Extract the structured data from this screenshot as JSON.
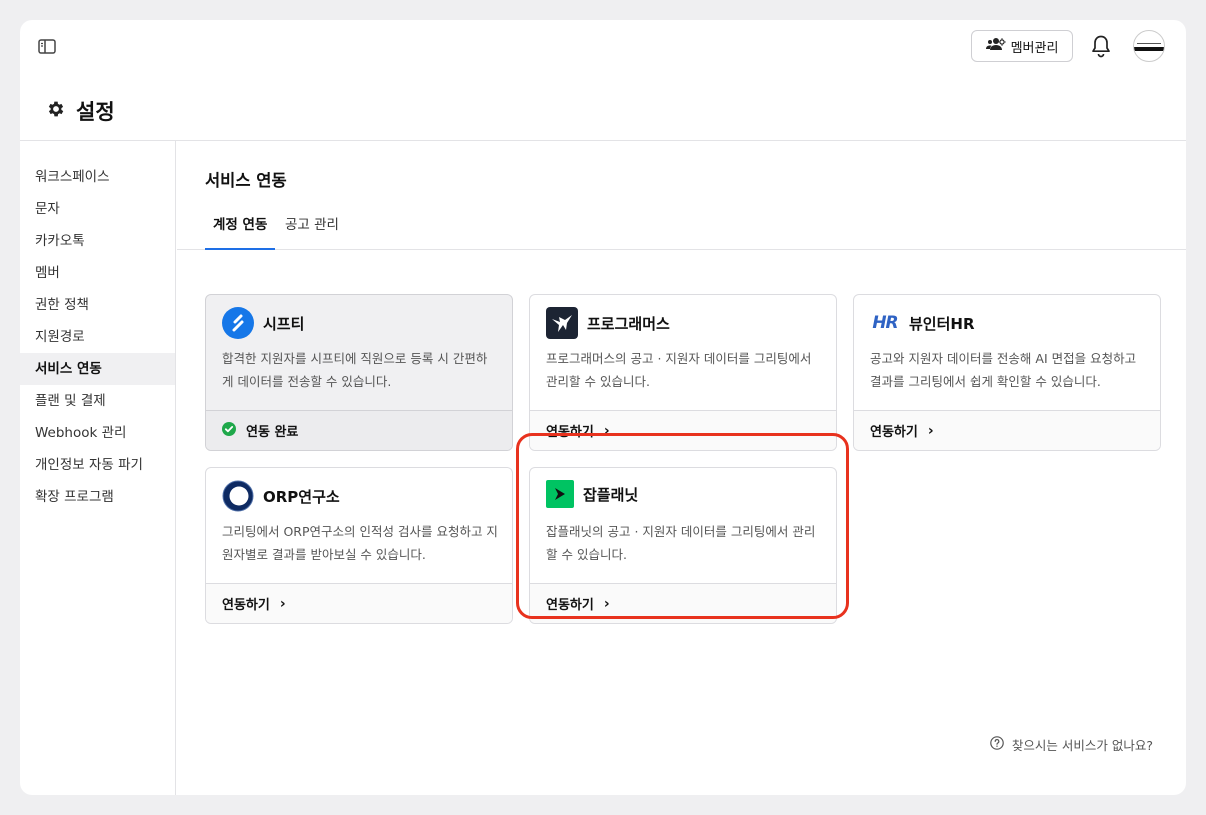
{
  "topbar": {
    "member_button_label": "멤버관리"
  },
  "page": {
    "title": "설정"
  },
  "sidebar": {
    "items": [
      {
        "label": "워크스페이스"
      },
      {
        "label": "문자"
      },
      {
        "label": "카카오톡"
      },
      {
        "label": "멤버"
      },
      {
        "label": "권한 정책"
      },
      {
        "label": "지원경로"
      },
      {
        "label": "서비스 연동"
      },
      {
        "label": "플랜 및 결제"
      },
      {
        "label": "Webhook 관리"
      },
      {
        "label": "개인정보 자동 파기"
      },
      {
        "label": "확장 프로그램"
      }
    ],
    "active_index": 6
  },
  "main": {
    "section_title": "서비스 연동",
    "tabs": [
      {
        "label": "계정 연동"
      },
      {
        "label": "공고 관리"
      }
    ],
    "cards": [
      {
        "title": "시프티",
        "description": "합격한 지원자를 시프티에 직원으로 등록 시 간편하게 데이터를 전송할 수 있습니다.",
        "footer": "연동 완료",
        "status": "connected"
      },
      {
        "title": "프로그래머스",
        "description": "프로그래머스의 공고 · 지원자 데이터를 그리팅에서 관리할 수 있습니다.",
        "footer": "연동하기"
      },
      {
        "title": "뷰인터HR",
        "logo_text": "HR",
        "description": "공고와 지원자 데이터를 전송해 AI 면접을 요청하고 결과를 그리팅에서 쉽게 확인할 수 있습니다.",
        "footer": "연동하기"
      },
      {
        "title": "ORP연구소",
        "description": "그리팅에서 ORP연구소의 인적성 검사를 요청하고 지원자별로 결과를 받아보실 수 있습니다.",
        "footer": "연동하기"
      },
      {
        "title": "잡플래닛",
        "description": "잡플래닛의 공고 · 지원자 데이터를 그리팅에서 관리할 수 있습니다.",
        "footer": "연동하기"
      }
    ],
    "help_text": "찾으시는 서비스가 없나요?"
  },
  "colors": {
    "accent": "#1e6fe6",
    "highlight": "#e8321e",
    "connected_check": "#1fa84a",
    "jobplanet_green": "#00c362",
    "shiftee_blue": "#1677e8",
    "orp_navy": "#0e2a62"
  }
}
